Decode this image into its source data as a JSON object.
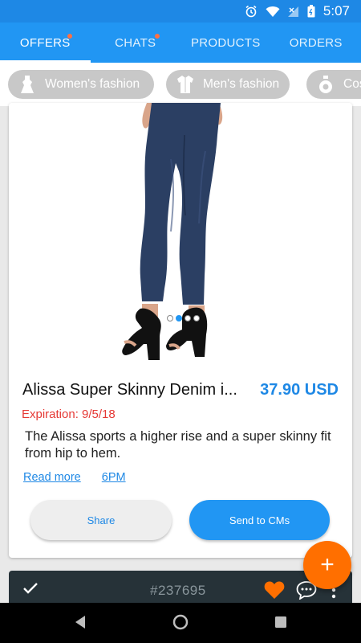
{
  "status_bar": {
    "time": "5:07"
  },
  "tabs": [
    {
      "label": "OFFERS",
      "active": true,
      "badge": true
    },
    {
      "label": "CHATS",
      "active": false,
      "badge": true
    },
    {
      "label": "PRODUCTS",
      "active": false,
      "badge": false
    },
    {
      "label": "ORDERS",
      "active": false,
      "badge": false
    }
  ],
  "categories": [
    {
      "label": "Women's fashion",
      "icon": "dress-icon"
    },
    {
      "label": "Men's fashion",
      "icon": "shirt-icon"
    },
    {
      "label": "Cos",
      "icon": "perfume-icon"
    }
  ],
  "product": {
    "title": "Alissa Super Skinny Denim i...",
    "price": "37.90 USD",
    "expiration": "Expiration:  9/5/18",
    "description": "The Alissa sports a higher rise and a super skinny fit from hip to hem.",
    "link_read_more": "Read more",
    "link_time": "6PM",
    "share_label": "Share",
    "send_label": "Send to CMs",
    "image_pager": {
      "count": 4,
      "active_index": 1
    }
  },
  "next_offer": {
    "number": "#237695"
  },
  "fab_label": "+",
  "colors": {
    "primary": "#2196f3",
    "accent": "#ff6f00",
    "price": "#1e88e5",
    "expiration": "#e53935"
  }
}
